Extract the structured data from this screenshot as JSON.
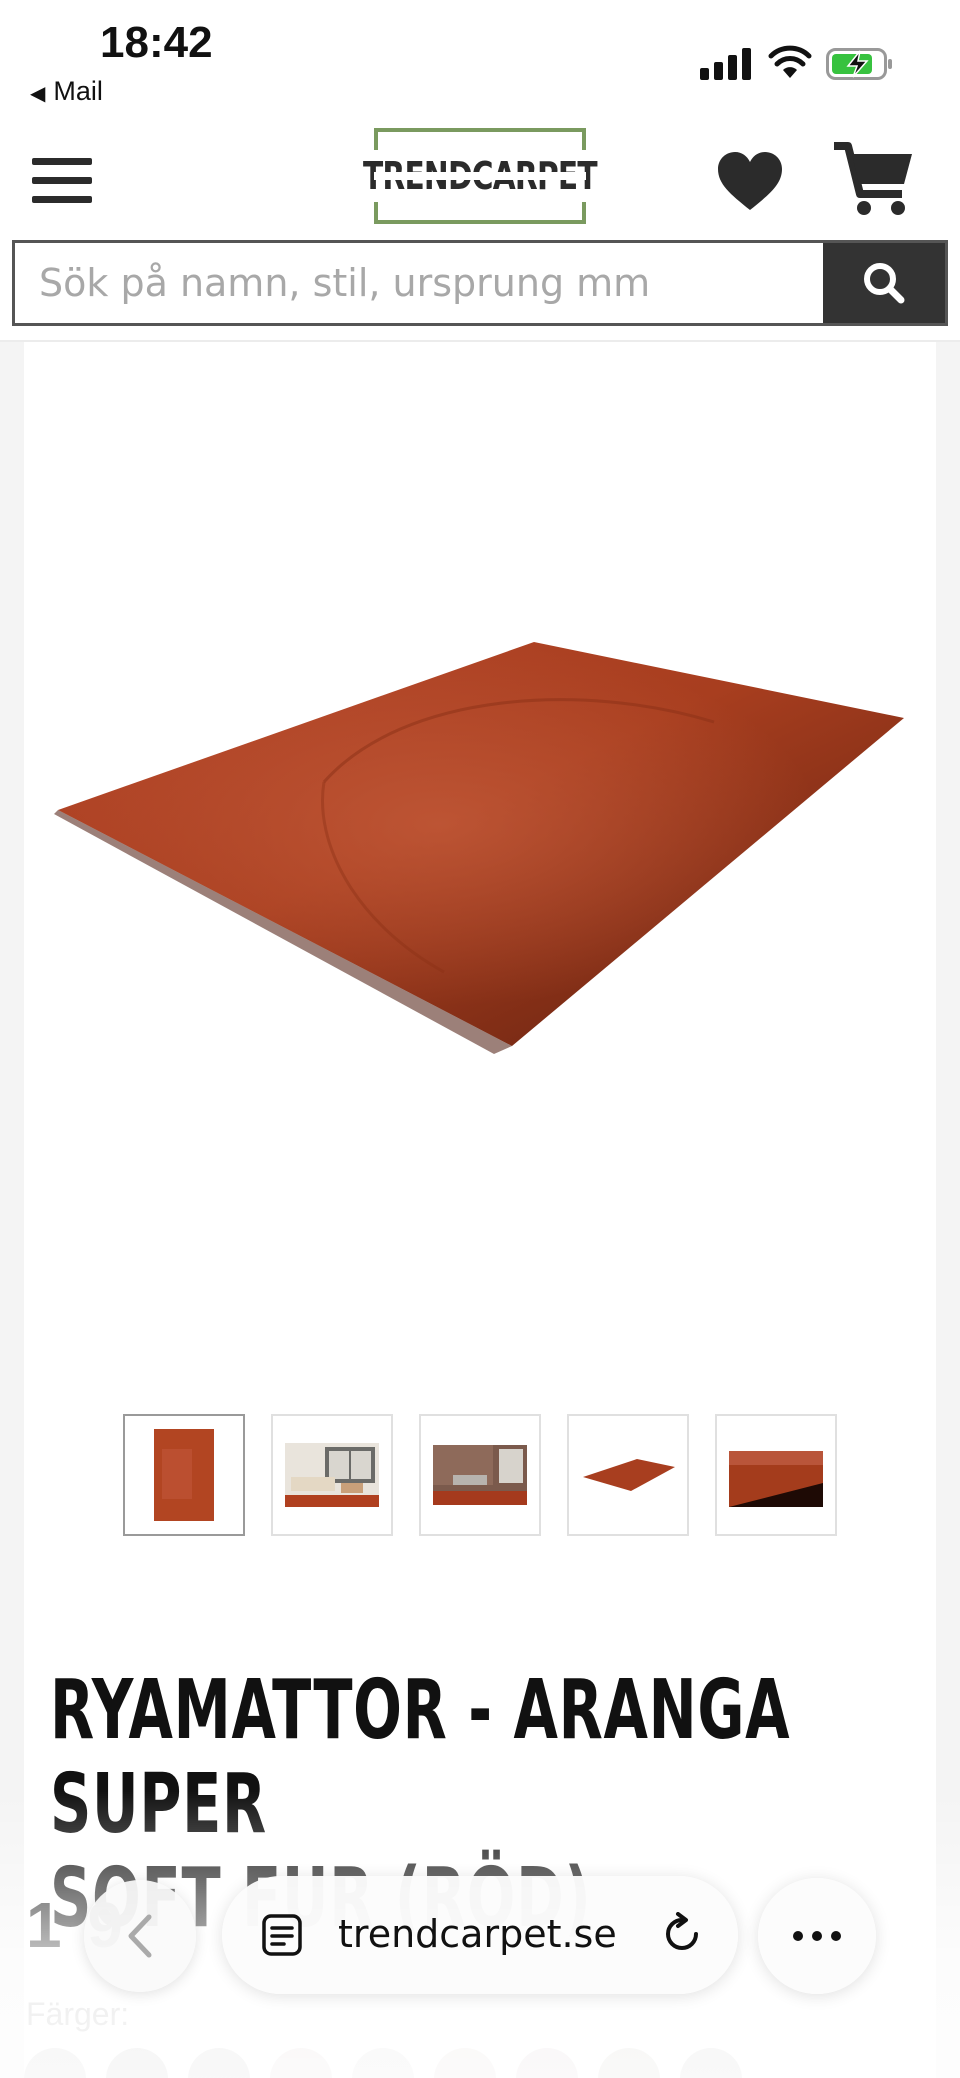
{
  "status_bar": {
    "time": "18:42",
    "back_app": "Mail"
  },
  "header": {
    "logo_text": "TRENDCARPET",
    "logo_border_color": "#7a9a5f",
    "icons": [
      "hamburger-menu-icon",
      "heart-icon",
      "cart-icon"
    ]
  },
  "search": {
    "placeholder": "Sök på namn, stil, ursprung mm",
    "button_icon": "search-icon"
  },
  "product": {
    "main_image_color": "#a83e1f",
    "thumbnails": [
      {
        "kind": "rug-top-view",
        "active": true
      },
      {
        "kind": "living-room-scene",
        "active": false
      },
      {
        "kind": "interior-scene",
        "active": false
      },
      {
        "kind": "rug-angled-view",
        "active": false
      },
      {
        "kind": "rug-closeup",
        "active": false
      }
    ],
    "title_line1": "RYAMATTOR - ARANGA SUPER",
    "title_line2": "SOFT FUR (RÖD)",
    "price_partial": "1 9",
    "colors_label": "Färger:",
    "swatch_colors": [
      "#d8d8d8",
      "#cfcfcf",
      "#d4d4d4",
      "#e6dede",
      "#e4e4e4",
      "#e8e0de",
      "#e3d8dc",
      "#dad9d2",
      "#d6d6d6"
    ]
  },
  "browser_bar": {
    "url": "trendcarpet.se",
    "icons": [
      "back-arrow-icon",
      "reader-icon",
      "reload-icon",
      "more-icon"
    ]
  }
}
